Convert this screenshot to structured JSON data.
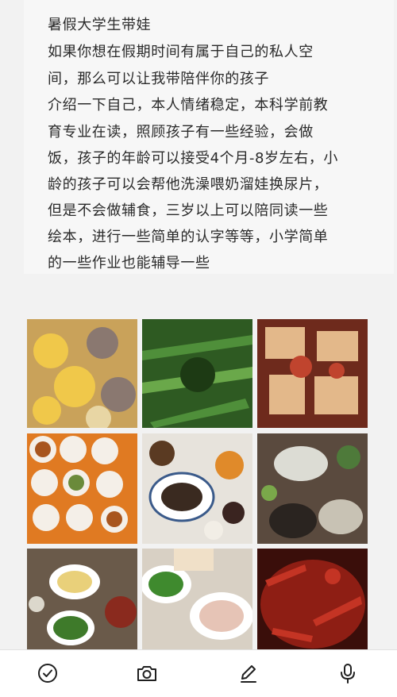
{
  "note": {
    "title": "暑假大学生带娃",
    "lines": [
      "如果你想在假期时间有属于自己的私人空",
      "间，那么可以让我带陪伴你的孩子",
      "介绍一下自己，本人情绪稳定，本科学前教",
      "育专业在读，照顾孩子有一些经验，会做",
      "饭，孩子的年龄可以接受4个月-8岁左右，小",
      "龄的孩子可以会帮他洗澡喂奶溜娃换尿片，",
      "但是不会做辅食，三岁以上可以陪同读一些",
      "绘本，进行一些简单的认字等等，小学简单",
      "的一些作业也能辅导一些"
    ]
  },
  "photos": [
    {
      "subject": "pork ribs and corn soup",
      "colors": [
        "#c9a25a",
        "#f0c84a",
        "#8a7870"
      ]
    },
    {
      "subject": "stir-fried green vegetables",
      "colors": [
        "#2e5a22",
        "#4f8f3a",
        "#1d3a14"
      ]
    },
    {
      "subject": "braised tofu with chili",
      "colors": [
        "#e3b88a",
        "#c0442e",
        "#6e2a1c"
      ]
    },
    {
      "subject": "many small plates on orange table",
      "colors": [
        "#e07a22",
        "#f4efe8",
        "#a8551e"
      ]
    },
    {
      "subject": "table with braised pork and side dishes",
      "colors": [
        "#e7e3dc",
        "#3a2a20",
        "#c9b8a4"
      ]
    },
    {
      "subject": "hotpot table spread",
      "colors": [
        "#5a4a3e",
        "#dcdcd4",
        "#2a2420"
      ]
    },
    {
      "subject": "table with potatoes and green beans",
      "colors": [
        "#6a5a4a",
        "#e9d07a",
        "#3e7a2a"
      ]
    },
    {
      "subject": "green peppers and pork slices",
      "colors": [
        "#d8d0c4",
        "#3f8a2e",
        "#e6c4b6"
      ]
    },
    {
      "subject": "spicy crayfish",
      "colors": [
        "#8e1e14",
        "#c43424",
        "#3a0e0a"
      ]
    }
  ],
  "toolbar": {
    "items": [
      {
        "icon": "check-circle-icon"
      },
      {
        "icon": "camera-icon"
      },
      {
        "icon": "pencil-icon"
      },
      {
        "icon": "microphone-icon"
      }
    ],
    "icon_color": "#1f1f1f"
  }
}
